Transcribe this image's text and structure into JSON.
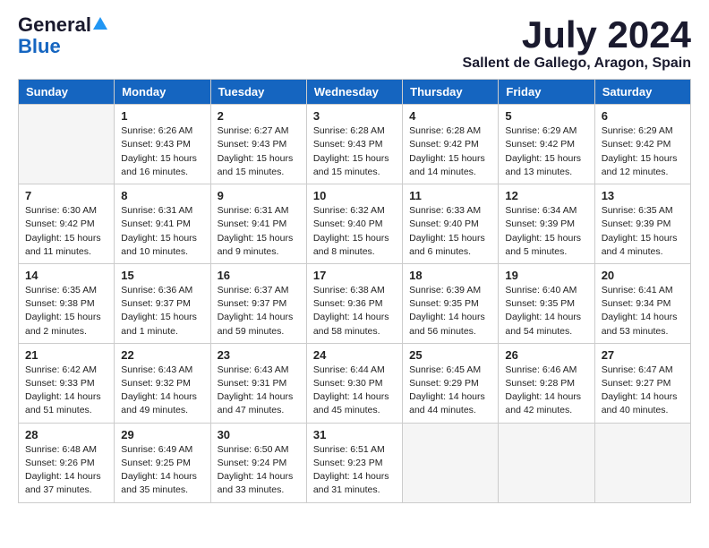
{
  "header": {
    "logo_general": "General",
    "logo_blue": "Blue",
    "month_title": "July 2024",
    "location": "Sallent de Gallego, Aragon, Spain"
  },
  "weekdays": [
    "Sunday",
    "Monday",
    "Tuesday",
    "Wednesday",
    "Thursday",
    "Friday",
    "Saturday"
  ],
  "weeks": [
    [
      {
        "day": "",
        "empty": true
      },
      {
        "day": "1",
        "sunrise": "6:26 AM",
        "sunset": "9:43 PM",
        "daylight": "15 hours and 16 minutes."
      },
      {
        "day": "2",
        "sunrise": "6:27 AM",
        "sunset": "9:43 PM",
        "daylight": "15 hours and 15 minutes."
      },
      {
        "day": "3",
        "sunrise": "6:28 AM",
        "sunset": "9:43 PM",
        "daylight": "15 hours and 15 minutes."
      },
      {
        "day": "4",
        "sunrise": "6:28 AM",
        "sunset": "9:42 PM",
        "daylight": "15 hours and 14 minutes."
      },
      {
        "day": "5",
        "sunrise": "6:29 AM",
        "sunset": "9:42 PM",
        "daylight": "15 hours and 13 minutes."
      },
      {
        "day": "6",
        "sunrise": "6:29 AM",
        "sunset": "9:42 PM",
        "daylight": "15 hours and 12 minutes."
      }
    ],
    [
      {
        "day": "7",
        "sunrise": "6:30 AM",
        "sunset": "9:42 PM",
        "daylight": "15 hours and 11 minutes."
      },
      {
        "day": "8",
        "sunrise": "6:31 AM",
        "sunset": "9:41 PM",
        "daylight": "15 hours and 10 minutes."
      },
      {
        "day": "9",
        "sunrise": "6:31 AM",
        "sunset": "9:41 PM",
        "daylight": "15 hours and 9 minutes."
      },
      {
        "day": "10",
        "sunrise": "6:32 AM",
        "sunset": "9:40 PM",
        "daylight": "15 hours and 8 minutes."
      },
      {
        "day": "11",
        "sunrise": "6:33 AM",
        "sunset": "9:40 PM",
        "daylight": "15 hours and 6 minutes."
      },
      {
        "day": "12",
        "sunrise": "6:34 AM",
        "sunset": "9:39 PM",
        "daylight": "15 hours and 5 minutes."
      },
      {
        "day": "13",
        "sunrise": "6:35 AM",
        "sunset": "9:39 PM",
        "daylight": "15 hours and 4 minutes."
      }
    ],
    [
      {
        "day": "14",
        "sunrise": "6:35 AM",
        "sunset": "9:38 PM",
        "daylight": "15 hours and 2 minutes."
      },
      {
        "day": "15",
        "sunrise": "6:36 AM",
        "sunset": "9:37 PM",
        "daylight": "15 hours and 1 minute."
      },
      {
        "day": "16",
        "sunrise": "6:37 AM",
        "sunset": "9:37 PM",
        "daylight": "14 hours and 59 minutes."
      },
      {
        "day": "17",
        "sunrise": "6:38 AM",
        "sunset": "9:36 PM",
        "daylight": "14 hours and 58 minutes."
      },
      {
        "day": "18",
        "sunrise": "6:39 AM",
        "sunset": "9:35 PM",
        "daylight": "14 hours and 56 minutes."
      },
      {
        "day": "19",
        "sunrise": "6:40 AM",
        "sunset": "9:35 PM",
        "daylight": "14 hours and 54 minutes."
      },
      {
        "day": "20",
        "sunrise": "6:41 AM",
        "sunset": "9:34 PM",
        "daylight": "14 hours and 53 minutes."
      }
    ],
    [
      {
        "day": "21",
        "sunrise": "6:42 AM",
        "sunset": "9:33 PM",
        "daylight": "14 hours and 51 minutes."
      },
      {
        "day": "22",
        "sunrise": "6:43 AM",
        "sunset": "9:32 PM",
        "daylight": "14 hours and 49 minutes."
      },
      {
        "day": "23",
        "sunrise": "6:43 AM",
        "sunset": "9:31 PM",
        "daylight": "14 hours and 47 minutes."
      },
      {
        "day": "24",
        "sunrise": "6:44 AM",
        "sunset": "9:30 PM",
        "daylight": "14 hours and 45 minutes."
      },
      {
        "day": "25",
        "sunrise": "6:45 AM",
        "sunset": "9:29 PM",
        "daylight": "14 hours and 44 minutes."
      },
      {
        "day": "26",
        "sunrise": "6:46 AM",
        "sunset": "9:28 PM",
        "daylight": "14 hours and 42 minutes."
      },
      {
        "day": "27",
        "sunrise": "6:47 AM",
        "sunset": "9:27 PM",
        "daylight": "14 hours and 40 minutes."
      }
    ],
    [
      {
        "day": "28",
        "sunrise": "6:48 AM",
        "sunset": "9:26 PM",
        "daylight": "14 hours and 37 minutes."
      },
      {
        "day": "29",
        "sunrise": "6:49 AM",
        "sunset": "9:25 PM",
        "daylight": "14 hours and 35 minutes."
      },
      {
        "day": "30",
        "sunrise": "6:50 AM",
        "sunset": "9:24 PM",
        "daylight": "14 hours and 33 minutes."
      },
      {
        "day": "31",
        "sunrise": "6:51 AM",
        "sunset": "9:23 PM",
        "daylight": "14 hours and 31 minutes."
      },
      {
        "day": "",
        "empty": true
      },
      {
        "day": "",
        "empty": true
      },
      {
        "day": "",
        "empty": true
      }
    ]
  ]
}
